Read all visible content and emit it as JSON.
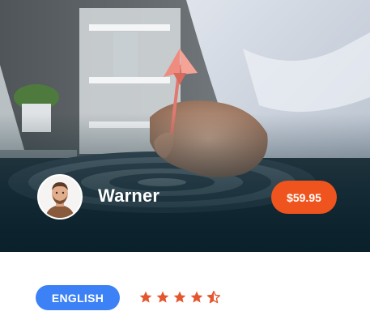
{
  "author": {
    "name": "Warner"
  },
  "course": {
    "price": "$59.95",
    "category": "ENGLISH",
    "rating": 4.5,
    "rating_max": 5
  },
  "icons": {
    "avatar": "author-avatar-photo",
    "star": "star-icon",
    "half_star": "star-half-icon"
  },
  "colors": {
    "price_badge": "#f0541e",
    "category_pill": "#3c82f6",
    "stars": "#e4572e"
  }
}
